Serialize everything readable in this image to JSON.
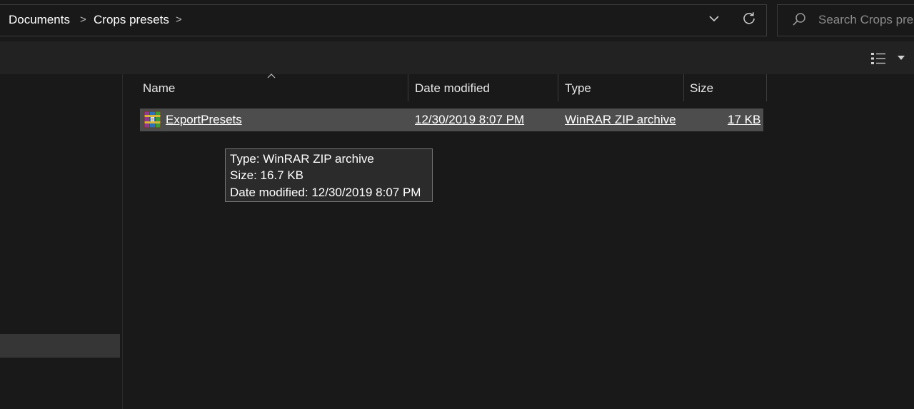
{
  "address_bar": {
    "breadcrumbs": [
      "Documents",
      "Crops presets"
    ],
    "separator": ">",
    "dropdown_icon": "chevron-down-icon",
    "refresh_icon": "refresh-icon"
  },
  "search": {
    "placeholder": "Search Crops presets",
    "icon": "search-icon"
  },
  "toolbar": {
    "view_icon": "details-view-icon",
    "view_dropdown_icon": "chevron-down-icon"
  },
  "columns": [
    "Name",
    "Date modified",
    "Type",
    "Size"
  ],
  "sort_indicator": "^",
  "files": [
    {
      "name": "ExportPresets",
      "date_modified": "12/30/2019 8:07 PM",
      "type": "WinRAR ZIP archive",
      "size": "17 KB",
      "icon": "winrar-archive-icon"
    }
  ],
  "tooltip": {
    "type_line": "Type: WinRAR ZIP archive",
    "size_line": "Size: 16.7 KB",
    "date_line": "Date modified: 12/30/2019 8:07 PM"
  },
  "colors": {
    "background": "#191919",
    "toolbar": "#222222",
    "selected_row": "#4d4d4d",
    "tooltip_bg": "#2b2b2b",
    "tooltip_border": "#767676"
  }
}
